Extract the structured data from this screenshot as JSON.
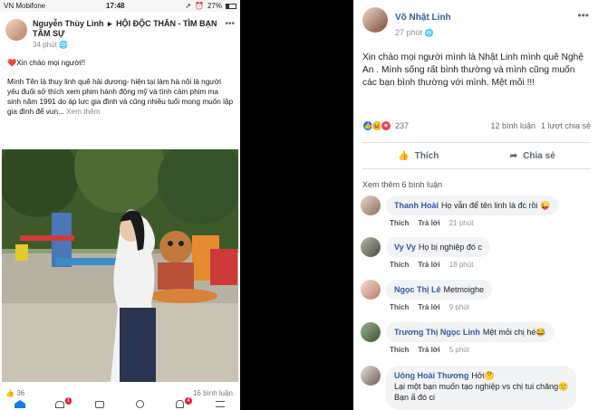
{
  "phone": {
    "status": {
      "carrier": "VN Mobifone",
      "time": "17:48",
      "battery": "27%"
    },
    "post": {
      "author": "Nguyễn Thùy Linh",
      "arrow": "▸",
      "group": "HỘI ĐỘC THÂN - TÌM BẠN TÂM SỰ",
      "time": "34 phút",
      "greeting": "Xin chào mọi người!!",
      "body": "Mình Tên là thuy linh  quê hải dương- hiện tại làm hà nội  là người  yếu đuối   sở thích xem phim hành động mỹ  và tình cảm phim ma",
      "body2": "sinh năm 1991  do áp lưc gia đình và cũng nhiều tuổi mong muốn lập gia đình để vun... ",
      "see_more": "Xem thêm",
      "reactions": "36",
      "comments": "16 bình luận"
    },
    "tabs": [
      {
        "icon": "home-icon"
      },
      {
        "icon": "groups-icon",
        "badge": "1"
      },
      {
        "icon": "watch-icon"
      },
      {
        "icon": "profile-icon"
      },
      {
        "icon": "notifications-icon",
        "badge": "4"
      },
      {
        "icon": "menu-icon"
      }
    ]
  },
  "post": {
    "author": "Võ Nhật Linh",
    "time": "27 phút",
    "text": "Xin chào mọi người mình là Nhật Linh mình quê Nghệ An . Mình sống rất bình thường và mình cũng muốn các bạn bình thường với mình. Mệt mỏi !!!",
    "reaction_count": "237",
    "comments_count": "12 bình luận",
    "shares_count": "1 lượt chia sẻ",
    "like_label": "Thích",
    "share_label": "Chia sẻ",
    "more_comments": "Xem thêm 6 bình luận"
  },
  "comments": [
    {
      "name": "Thanh Hoài",
      "text": "Họ vẫn để tên linh là đc rồi 😜",
      "like": "Thích",
      "reply": "Trả lời",
      "time": "21 phút"
    },
    {
      "name": "Vy Vy",
      "text": "Họ bị nghiệp đó c",
      "like": "Thích",
      "reply": "Trả lời",
      "time": "18 phút"
    },
    {
      "name": "Ngọc Thị Lê",
      "text": "Metmoighe",
      "like": "Thích",
      "reply": "Trả lời",
      "time": "9 phút"
    },
    {
      "name": "Trương Thị Ngọc Linh",
      "text": "Mệt mỏi chị hé😂",
      "like": "Thích",
      "reply": "Trả lời",
      "time": "5 phút"
    },
    {
      "name": "Uông Hoài Thương",
      "text": "Hởi🤔",
      "text2": "Lại một bạn muốn tạo nghiệp vs chị tui chăng🙂",
      "text3": "Bạn ấ đó ci"
    }
  ],
  "colors": {
    "fb_blue": "#4267b2",
    "link": "#385898",
    "like_blue": "#1877f2",
    "love_red": "#f33e58",
    "haha_yellow": "#f7b125"
  }
}
